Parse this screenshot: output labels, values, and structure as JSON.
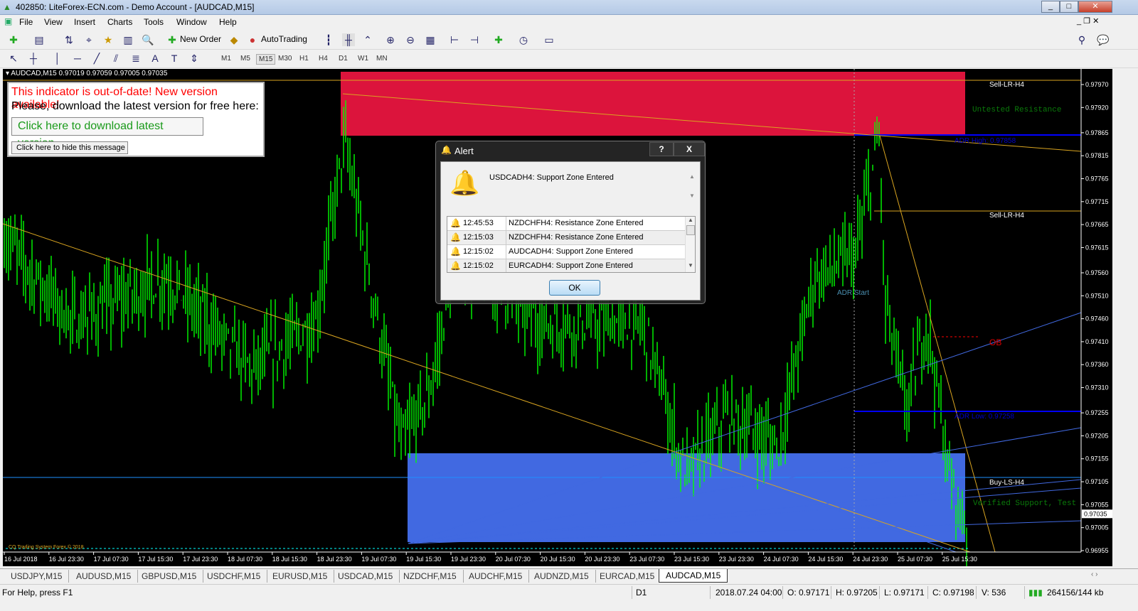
{
  "window": {
    "title": "402850: LiteForex-ECN.com - Demo Account - [AUDCAD,M15]"
  },
  "menu": [
    "File",
    "View",
    "Insert",
    "Charts",
    "Tools",
    "Window",
    "Help"
  ],
  "toolbar": {
    "new_order": "New Order",
    "autotrading": "AutoTrading",
    "timeframes": [
      "M1",
      "M5",
      "M15",
      "M30",
      "H1",
      "H4",
      "D1",
      "W1",
      "MN"
    ],
    "active_timeframe": "M15"
  },
  "chart": {
    "header": "AUDCAD,M15",
    "ohlc": "0.97019 0.97059 0.97005 0.97035",
    "price_ticks": [
      "0.97970",
      "0.97920",
      "0.97865",
      "0.97815",
      "0.97765",
      "0.97715",
      "0.97665",
      "0.97615",
      "0.97560",
      "0.97510",
      "0.97460",
      "0.97410",
      "0.97360",
      "0.97310",
      "0.97255",
      "0.97205",
      "0.97155",
      "0.97105",
      "0.97055",
      "0.97005",
      "0.96955"
    ],
    "current_price": "0.97035",
    "time_ticks": [
      "16 Jul 2018",
      "16 Jul 23:30",
      "17 Jul 07:30",
      "17 Jul 15:30",
      "17 Jul 23:30",
      "18 Jul 07:30",
      "18 Jul 15:30",
      "18 Jul 23:30",
      "19 Jul 07:30",
      "19 Jul 15:30",
      "19 Jul 23:30",
      "20 Jul 07:30",
      "20 Jul 15:30",
      "20 Jul 23:30",
      "23 Jul 07:30",
      "23 Jul 15:30",
      "23 Jul 23:30",
      "24 Jul 07:30",
      "24 Jul 15:30",
      "24 Jul 23:30",
      "25 Jul 07:30",
      "25 Jul 15:30"
    ],
    "labels": {
      "sell_lr_1": "Sell-LR-H4",
      "untested": "Untested Resistance",
      "adr_high": "ADR High: 0.97858",
      "sell_lr_2": "Sell-LR-H4",
      "adr_start": "ADR Start",
      "ob": "OB",
      "adr_low": "ADR Low: 0.97258",
      "buy_ls": "Buy-LS-H4",
      "verified": "Verified Support, Test",
      "copyright": "CQ Trading System Forex © 2018"
    },
    "colors": {
      "resistance_zone": "#dc143c",
      "support_zone": "#4169e1",
      "bars": "#00ff00",
      "adr": "#0000ff",
      "trend": "#daa520"
    }
  },
  "notice": {
    "line1": "This indicator is out-of-date! New version available!",
    "line2": "Please, download the latest version for free here:",
    "download": "Click here to download latest version",
    "hide": "Click here to hide this message"
  },
  "alert": {
    "title": "Alert",
    "help": "?",
    "close": "X",
    "message": "USDCADH4: Support Zone Entered",
    "ok": "OK",
    "history": [
      {
        "time": "12:45:53",
        "msg": "NZDCHFH4: Resistance Zone Entered"
      },
      {
        "time": "12:15:03",
        "msg": "NZDCHFH4: Resistance Zone Entered"
      },
      {
        "time": "12:15:02",
        "msg": "AUDCADH4: Support Zone Entered"
      },
      {
        "time": "12:15:02",
        "msg": "EURCADH4: Support Zone Entered"
      }
    ]
  },
  "tabs": [
    "USDJPY,M15",
    "AUDUSD,M15",
    "GBPUSD,M15",
    "USDCHF,M15",
    "EURUSD,M15",
    "USDCAD,M15",
    "NZDCHF,M15",
    "AUDCHF,M15",
    "AUDNZD,M15",
    "EURCAD,M15",
    "AUDCAD,M15"
  ],
  "active_tab": "AUDCAD,M15",
  "status": {
    "help": "For Help, press F1",
    "profile": "D1",
    "datetime": "2018.07.24 04:00",
    "open": "O: 0.97171",
    "high": "H: 0.97205",
    "low": "L: 0.97171",
    "close": "C: 0.97198",
    "volume": "V: 536",
    "traffic": "264156/144 kb"
  }
}
